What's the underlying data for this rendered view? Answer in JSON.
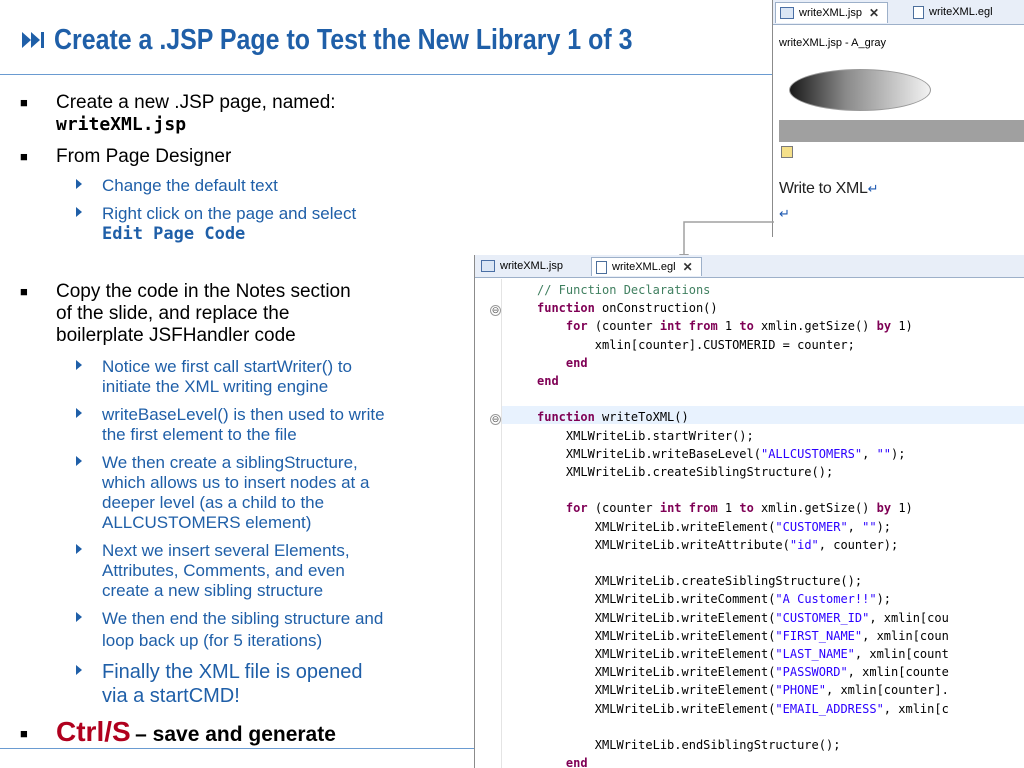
{
  "title": "Create a .JSP Page to Test the New Library 1 of 3",
  "bullets": {
    "b1_text": "Create a new .JSP page, named:",
    "b1_code": "writeXML.jsp",
    "b2_text": "From Page Designer",
    "b2_sub1": "Change the default text",
    "b2_sub2_text": "Right click on the page and select",
    "b2_sub2_code": "Edit Page Code",
    "b3_l1": "Copy the code in the Notes section",
    "b3_l2": "of the slide, and replace the",
    "b3_l3": "boilerplate JSFHandler code",
    "s1_l1": "Notice we first call startWriter() to",
    "s1_l2": "initiate the XML writing engine",
    "s2_l1": "writeBaseLevel() is then used to write",
    "s2_l2": "the first element to the file",
    "s3_l1": "We then create a siblingStructure,",
    "s3_l2": "which allows us to insert nodes at a",
    "s3_l3": "deeper level (as a child to the",
    "s3_l4": "ALLCUSTOMERS element)",
    "s4_l1": "Next we insert several Elements,",
    "s4_l2": "Attributes, Comments, and even",
    "s4_l3": "create a new sibling structure",
    "s5_l1": "We then end the sibling structure and",
    "s5_l2": "loop back up (for 5 iterations)",
    "s6_l1": "Finally the XML file is opened",
    "s6_l2": "via a startCMD!",
    "ctrl_key": "Ctrl/S",
    "ctrl_rest": "– save and generate"
  },
  "designer": {
    "tab1": "writeXML.jsp",
    "tab1_close": "✕",
    "tab2": "writeXML.egl",
    "doc_title": "writeXML.jsp - A_gray",
    "write_text": "Write to XML",
    "return_mark": "↵"
  },
  "editor": {
    "tab1": "writeXML.jsp",
    "tab2": "writeXML.egl",
    "tab2_close": "✕",
    "fold_mark": "⊖"
  },
  "colors": {
    "title": "#1f5fa8",
    "sub_bullet": "#1f5fa8",
    "ctrl_key": "#b0001e",
    "keyword": "#7f0055",
    "comment": "#3f7f5f",
    "string": "#2a00ff"
  }
}
